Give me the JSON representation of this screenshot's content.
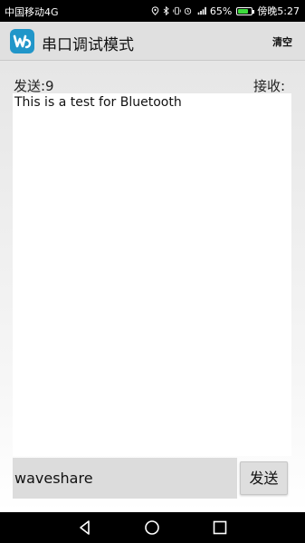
{
  "status_bar": {
    "carrier": "中国移动4G",
    "battery": "65%",
    "battery_level": 0.65,
    "battery_color": "#3ddc3d",
    "time_label": "傍晚5:27",
    "icons": [
      "location-icon",
      "bluetooth-icon",
      "vibrate-icon",
      "alarm-icon",
      "signal-icon",
      "battery-icon"
    ]
  },
  "action_bar": {
    "title": "串口调试模式",
    "clear_label": "清空",
    "logo_color": "#2196c9"
  },
  "main": {
    "send_count_label": "发送:9",
    "receive_label": "接收:",
    "received_text": "This is a test for Bluetooth",
    "input_value": "waveshare",
    "send_button_label": "发送"
  },
  "nav_bar": {
    "icons": [
      "back-icon",
      "home-icon",
      "recents-icon"
    ]
  }
}
